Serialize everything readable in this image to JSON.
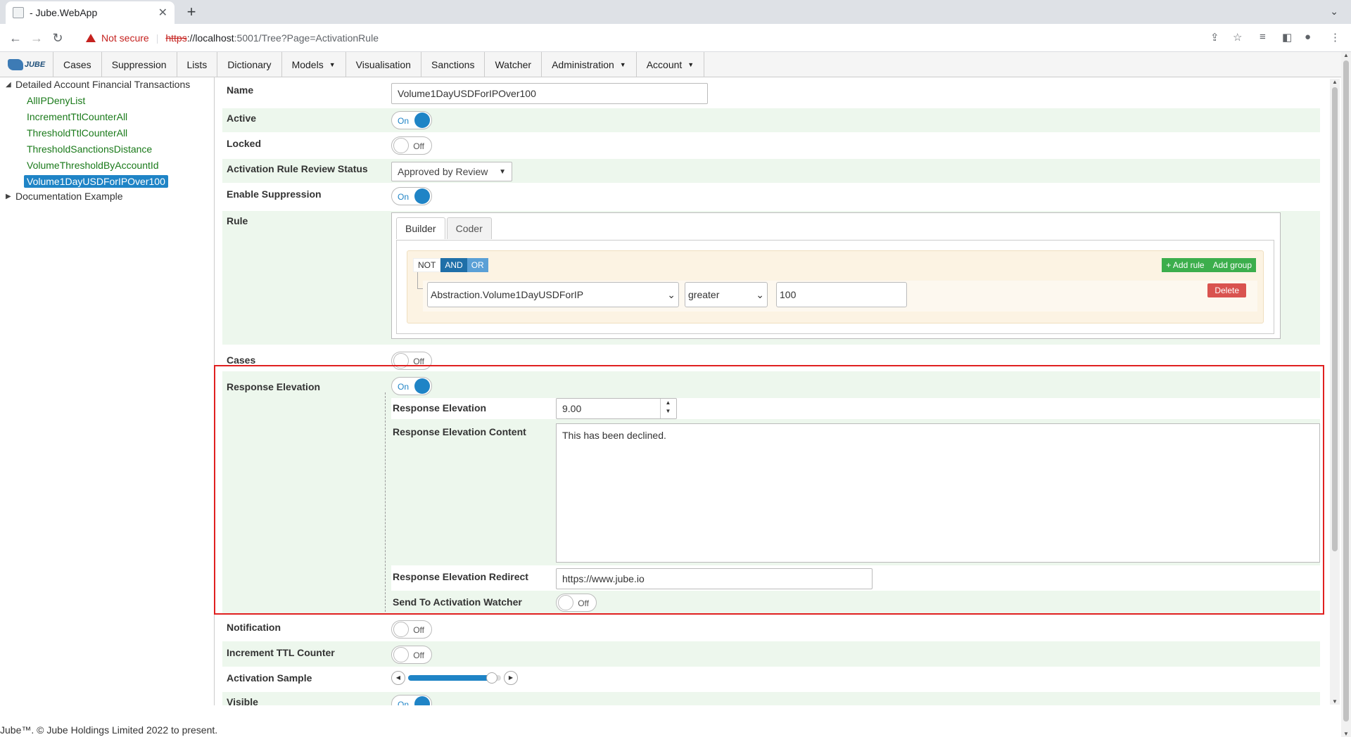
{
  "browser": {
    "tab_title": "- Jube.WebApp",
    "close": "✕",
    "new_tab": "+",
    "warning": "Not secure",
    "url_scheme": "https",
    "url_host": "://localhost",
    "url_rest": ":5001/Tree?Page=ActivationRule"
  },
  "app_nav": {
    "logo": "JUBE",
    "items": [
      "Cases",
      "Suppression",
      "Lists",
      "Dictionary",
      "Models",
      "Visualisation",
      "Sanctions",
      "Watcher",
      "Administration",
      "Account"
    ]
  },
  "tree": {
    "root": "Detailed Account Financial Transactions",
    "leaves": [
      "AllIPDenyList",
      "IncrementTtlCounterAll",
      "ThresholdTtlCounterAll",
      "ThresholdSanctionsDistance",
      "VolumeThresholdByAccountId",
      "Volume1DayUSDForIPOver100"
    ],
    "second_root": "Documentation Example"
  },
  "form": {
    "name_label": "Name",
    "name_value": "Volume1DayUSDForIPOver100",
    "active_label": "Active",
    "locked_label": "Locked",
    "review_status_label": "Activation Rule Review Status",
    "review_status_value": "Approved by Review",
    "enable_suppression_label": "Enable Suppression",
    "rule_label": "Rule",
    "cases_label": "Cases",
    "response_elevation_label": "Response Elevation",
    "response_elevation_sub_label": "Response Elevation",
    "response_elevation_value": "9.00",
    "response_elevation_content_label": "Response Elevation Content",
    "response_elevation_content_value": "This has been declined.",
    "response_elevation_redirect_label": "Response Elevation Redirect",
    "response_elevation_redirect_value": "https://www.jube.io",
    "send_to_watcher_label": "Send To Activation Watcher",
    "notification_label": "Notification",
    "increment_ttl_label": "Increment TTL Counter",
    "activation_sample_label": "Activation Sample",
    "activation_sample_level": 0.9,
    "visible_label": "Visible"
  },
  "toggles": {
    "on": "On",
    "off": "Off"
  },
  "rule_builder": {
    "tab_builder": "Builder",
    "tab_coder": "Coder",
    "not": "NOT",
    "and": "AND",
    "or": "OR",
    "add_rule": "+ Add rule",
    "add_group": "Add group",
    "field": "Abstraction.Volume1DayUSDForIP",
    "operator": "greater",
    "value": "100",
    "delete": "Delete"
  },
  "footer": "Jube™. © Jube Holdings Limited 2022 to present."
}
